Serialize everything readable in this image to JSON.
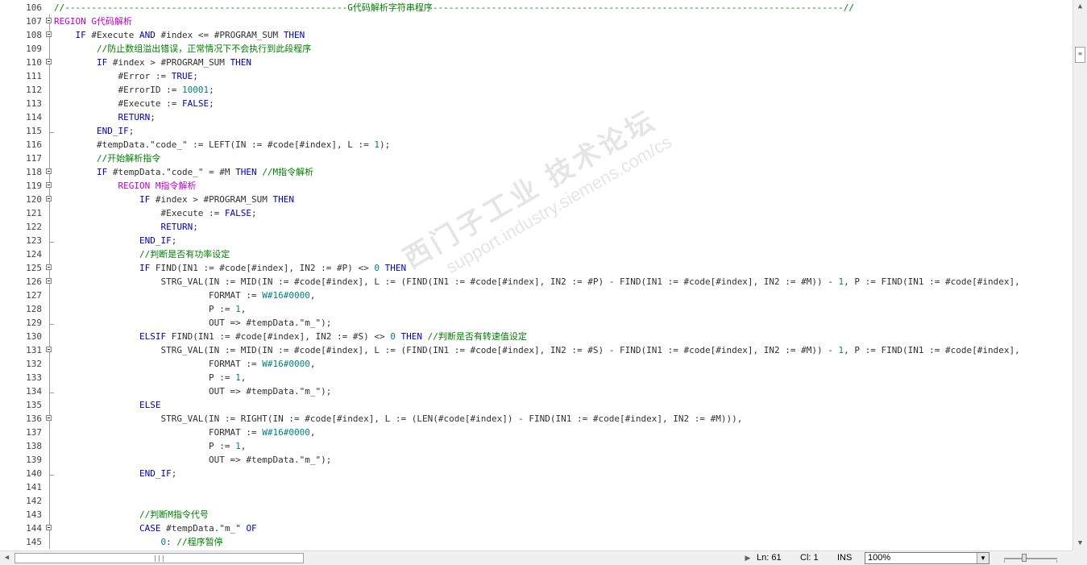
{
  "editor": {
    "lines": [
      {
        "n": "106",
        "fold": "",
        "tokens": [
          {
            "c": "cm",
            "t": "//-----------------------------------------------------G代码解析字符串程序-----------------------------------------------------------------------------//"
          }
        ]
      },
      {
        "n": "107",
        "fold": "open",
        "tokens": [
          {
            "c": "rg",
            "t": "REGION G代码解析"
          }
        ]
      },
      {
        "n": "108",
        "fold": "open",
        "tokens": [
          {
            "c": "tx",
            "t": "    "
          },
          {
            "c": "kw",
            "t": "IF"
          },
          {
            "c": "tx",
            "t": " #Execute "
          },
          {
            "c": "kw",
            "t": "AND"
          },
          {
            "c": "tx",
            "t": " #index <= #PROGRAM_SUM "
          },
          {
            "c": "kw",
            "t": "THEN"
          }
        ]
      },
      {
        "n": "109",
        "fold": "",
        "tokens": [
          {
            "c": "tx",
            "t": "        "
          },
          {
            "c": "cm",
            "t": "//防止数组溢出错误，正常情况下不会执行到此段程序"
          }
        ]
      },
      {
        "n": "110",
        "fold": "open",
        "tokens": [
          {
            "c": "tx",
            "t": "        "
          },
          {
            "c": "kw",
            "t": "IF"
          },
          {
            "c": "tx",
            "t": " #index > #PROGRAM_SUM "
          },
          {
            "c": "kw",
            "t": "THEN"
          }
        ]
      },
      {
        "n": "111",
        "fold": "",
        "tokens": [
          {
            "c": "tx",
            "t": "            #Error := "
          },
          {
            "c": "kw",
            "t": "TRUE"
          },
          {
            "c": "tx",
            "t": ";"
          }
        ]
      },
      {
        "n": "112",
        "fold": "",
        "tokens": [
          {
            "c": "tx",
            "t": "            #ErrorID := "
          },
          {
            "c": "nm",
            "t": "10001"
          },
          {
            "c": "tx",
            "t": ";"
          }
        ]
      },
      {
        "n": "113",
        "fold": "",
        "tokens": [
          {
            "c": "tx",
            "t": "            #Execute := "
          },
          {
            "c": "kw",
            "t": "FALSE"
          },
          {
            "c": "tx",
            "t": ";"
          }
        ]
      },
      {
        "n": "114",
        "fold": "",
        "tokens": [
          {
            "c": "tx",
            "t": "            "
          },
          {
            "c": "kw",
            "t": "RETURN"
          },
          {
            "c": "tx",
            "t": ";"
          }
        ]
      },
      {
        "n": "115",
        "fold": "end",
        "tokens": [
          {
            "c": "tx",
            "t": "        "
          },
          {
            "c": "kw",
            "t": "END_IF"
          },
          {
            "c": "tx",
            "t": ";"
          }
        ]
      },
      {
        "n": "116",
        "fold": "",
        "tokens": [
          {
            "c": "tx",
            "t": "        #tempData.\"code_\" := LEFT(IN := #code[#index], L := "
          },
          {
            "c": "nm",
            "t": "1"
          },
          {
            "c": "tx",
            "t": ");"
          }
        ]
      },
      {
        "n": "117",
        "fold": "",
        "tokens": [
          {
            "c": "tx",
            "t": "        "
          },
          {
            "c": "cm",
            "t": "//开始解析指令"
          }
        ]
      },
      {
        "n": "118",
        "fold": "open",
        "tokens": [
          {
            "c": "tx",
            "t": "        "
          },
          {
            "c": "kw",
            "t": "IF"
          },
          {
            "c": "tx",
            "t": " #tempData.\"code_\" = #M "
          },
          {
            "c": "kw",
            "t": "THEN"
          },
          {
            "c": "tx",
            "t": " "
          },
          {
            "c": "cm",
            "t": "//M指令解析"
          }
        ]
      },
      {
        "n": "119",
        "fold": "open",
        "tokens": [
          {
            "c": "tx",
            "t": "            "
          },
          {
            "c": "rg",
            "t": "REGION M指令解析"
          }
        ]
      },
      {
        "n": "120",
        "fold": "open",
        "tokens": [
          {
            "c": "tx",
            "t": "                "
          },
          {
            "c": "kw",
            "t": "IF"
          },
          {
            "c": "tx",
            "t": " #index > #PROGRAM_SUM "
          },
          {
            "c": "kw",
            "t": "THEN"
          }
        ]
      },
      {
        "n": "121",
        "fold": "",
        "tokens": [
          {
            "c": "tx",
            "t": "                    #Execute := "
          },
          {
            "c": "kw",
            "t": "FALSE"
          },
          {
            "c": "tx",
            "t": ";"
          }
        ]
      },
      {
        "n": "122",
        "fold": "",
        "tokens": [
          {
            "c": "tx",
            "t": "                    "
          },
          {
            "c": "kw",
            "t": "RETURN"
          },
          {
            "c": "tx",
            "t": ";"
          }
        ]
      },
      {
        "n": "123",
        "fold": "end",
        "tokens": [
          {
            "c": "tx",
            "t": "                "
          },
          {
            "c": "kw",
            "t": "END_IF"
          },
          {
            "c": "tx",
            "t": ";"
          }
        ]
      },
      {
        "n": "124",
        "fold": "",
        "tokens": [
          {
            "c": "tx",
            "t": "                "
          },
          {
            "c": "cm",
            "t": "//判断是否有功率设定"
          }
        ]
      },
      {
        "n": "125",
        "fold": "open",
        "tokens": [
          {
            "c": "tx",
            "t": "                "
          },
          {
            "c": "kw",
            "t": "IF"
          },
          {
            "c": "tx",
            "t": " FIND(IN1 := #code[#index], IN2 := #P) <> "
          },
          {
            "c": "nm",
            "t": "0"
          },
          {
            "c": "tx",
            "t": " "
          },
          {
            "c": "kw",
            "t": "THEN"
          }
        ]
      },
      {
        "n": "126",
        "fold": "open",
        "tokens": [
          {
            "c": "tx",
            "t": "                    STRG_VAL(IN := MID(IN := #code[#index], L := (FIND(IN1 := #code[#index], IN2 := #P) - FIND(IN1 := #code[#index], IN2 := #M)) - "
          },
          {
            "c": "nm",
            "t": "1"
          },
          {
            "c": "tx",
            "t": ", P := FIND(IN1 := #code[#index],"
          }
        ]
      },
      {
        "n": "127",
        "fold": "",
        "tokens": [
          {
            "c": "tx",
            "t": "                             FORMAT := "
          },
          {
            "c": "nm",
            "t": "W#16#0000"
          },
          {
            "c": "tx",
            "t": ","
          }
        ]
      },
      {
        "n": "128",
        "fold": "",
        "tokens": [
          {
            "c": "tx",
            "t": "                             P := "
          },
          {
            "c": "nm",
            "t": "1"
          },
          {
            "c": "tx",
            "t": ","
          }
        ]
      },
      {
        "n": "129",
        "fold": "end",
        "tokens": [
          {
            "c": "tx",
            "t": "                             OUT => #tempData.\"m_\");"
          }
        ]
      },
      {
        "n": "130",
        "fold": "",
        "tokens": [
          {
            "c": "tx",
            "t": "                "
          },
          {
            "c": "kw",
            "t": "ELSIF"
          },
          {
            "c": "tx",
            "t": " FIND(IN1 := #code[#index], IN2 := #S) <> "
          },
          {
            "c": "nm",
            "t": "0"
          },
          {
            "c": "tx",
            "t": " "
          },
          {
            "c": "kw",
            "t": "THEN"
          },
          {
            "c": "tx",
            "t": " "
          },
          {
            "c": "cm",
            "t": "//判断是否有转速值设定"
          }
        ]
      },
      {
        "n": "131",
        "fold": "open",
        "tokens": [
          {
            "c": "tx",
            "t": "                    STRG_VAL(IN := MID(IN := #code[#index], L := (FIND(IN1 := #code[#index], IN2 := #S) - FIND(IN1 := #code[#index], IN2 := #M)) - "
          },
          {
            "c": "nm",
            "t": "1"
          },
          {
            "c": "tx",
            "t": ", P := FIND(IN1 := #code[#index],"
          }
        ]
      },
      {
        "n": "132",
        "fold": "",
        "tokens": [
          {
            "c": "tx",
            "t": "                             FORMAT := "
          },
          {
            "c": "nm",
            "t": "W#16#0000"
          },
          {
            "c": "tx",
            "t": ","
          }
        ]
      },
      {
        "n": "133",
        "fold": "",
        "tokens": [
          {
            "c": "tx",
            "t": "                             P := "
          },
          {
            "c": "nm",
            "t": "1"
          },
          {
            "c": "tx",
            "t": ","
          }
        ]
      },
      {
        "n": "134",
        "fold": "end",
        "tokens": [
          {
            "c": "tx",
            "t": "                             OUT => #tempData.\"m_\");"
          }
        ]
      },
      {
        "n": "135",
        "fold": "",
        "tokens": [
          {
            "c": "tx",
            "t": "                "
          },
          {
            "c": "kw",
            "t": "ELSE"
          }
        ]
      },
      {
        "n": "136",
        "fold": "open",
        "tokens": [
          {
            "c": "tx",
            "t": "                    STRG_VAL(IN := RIGHT(IN := #code[#index], L := (LEN(#code[#index]) - FIND(IN1 := #code[#index], IN2 := #M))),"
          }
        ]
      },
      {
        "n": "137",
        "fold": "",
        "tokens": [
          {
            "c": "tx",
            "t": "                             FORMAT := "
          },
          {
            "c": "nm",
            "t": "W#16#0000"
          },
          {
            "c": "tx",
            "t": ","
          }
        ]
      },
      {
        "n": "138",
        "fold": "",
        "tokens": [
          {
            "c": "tx",
            "t": "                             P := "
          },
          {
            "c": "nm",
            "t": "1"
          },
          {
            "c": "tx",
            "t": ","
          }
        ]
      },
      {
        "n": "139",
        "fold": "",
        "tokens": [
          {
            "c": "tx",
            "t": "                             OUT => #tempData.\"m_\");"
          }
        ]
      },
      {
        "n": "140",
        "fold": "end",
        "tokens": [
          {
            "c": "tx",
            "t": "                "
          },
          {
            "c": "kw",
            "t": "END_IF"
          },
          {
            "c": "tx",
            "t": ";"
          }
        ]
      },
      {
        "n": "141",
        "fold": "",
        "tokens": []
      },
      {
        "n": "142",
        "fold": "",
        "tokens": []
      },
      {
        "n": "143",
        "fold": "",
        "tokens": [
          {
            "c": "tx",
            "t": "                "
          },
          {
            "c": "cm",
            "t": "//判断M指令代号"
          }
        ]
      },
      {
        "n": "144",
        "fold": "open",
        "tokens": [
          {
            "c": "tx",
            "t": "                "
          },
          {
            "c": "kw",
            "t": "CASE"
          },
          {
            "c": "tx",
            "t": " #tempData.\"m_\" "
          },
          {
            "c": "kw",
            "t": "OF"
          }
        ]
      },
      {
        "n": "145",
        "fold": "",
        "tokens": [
          {
            "c": "tx",
            "t": "                    "
          },
          {
            "c": "nm",
            "t": "0"
          },
          {
            "c": "tx",
            "t": ": "
          },
          {
            "c": "cm",
            "t": "//程序暂停"
          }
        ]
      }
    ]
  },
  "watermark": {
    "line1": "西门子工业  技术论坛",
    "line2": "support.industry.siemens.com/cs"
  },
  "status": {
    "ln": "Ln: 61",
    "col": "Cl: 1",
    "mode": "INS",
    "zoom": "100%"
  },
  "icons": {
    "up": "arrow-up-icon",
    "down": "arrow-down-icon",
    "left": "arrow-left-icon",
    "right": "arrow-right-icon"
  }
}
